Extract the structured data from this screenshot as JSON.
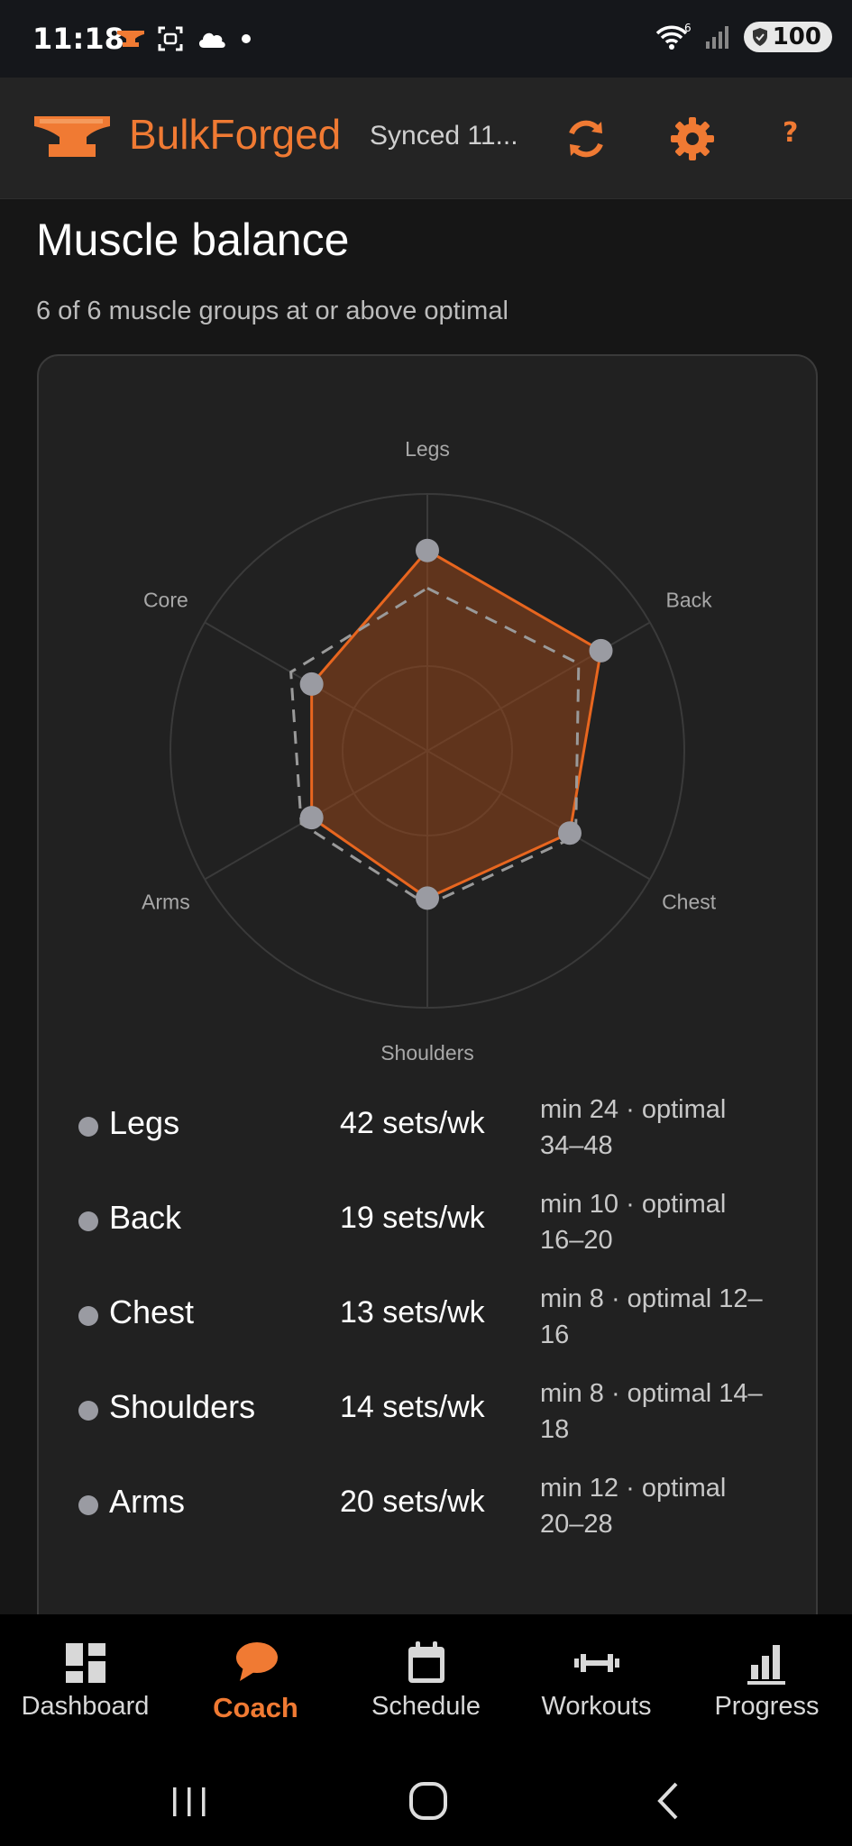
{
  "status_bar": {
    "time": "11:18",
    "signal_badge": "6",
    "battery": "100"
  },
  "app_bar": {
    "brand": "BulkForged",
    "sync_status": "Synced 11...",
    "help_label": "?",
    "accent_color": "#f07a33"
  },
  "page": {
    "title": "Muscle balance",
    "subtitle": "6 of 6 muscle groups at or above optimal"
  },
  "chart_data": {
    "type": "radar",
    "axes": [
      "Legs",
      "Back",
      "Chest",
      "Shoulders",
      "Arms",
      "Core"
    ],
    "series": [
      {
        "values": [
          1.17,
          1.17,
          0.96,
          0.86,
          0.78,
          0.78
        ],
        "color": "#e8661f"
      },
      {
        "values": [
          0.95,
          1.02,
          1.0,
          0.9,
          0.85,
          0.92
        ],
        "style": "dashed",
        "color": "#9a9a9a"
      }
    ],
    "range": [
      0,
      1.5
    ],
    "grid": "circular"
  },
  "legend": [
    {
      "name": "Legs",
      "sets": "42 sets/wk",
      "range": "min 24 · optimal 34–48"
    },
    {
      "name": "Back",
      "sets": "19 sets/wk",
      "range": "min 10 · optimal 16–20"
    },
    {
      "name": "Chest",
      "sets": "13 sets/wk",
      "range": "min 8 · optimal 12–16"
    },
    {
      "name": "Shoulders",
      "sets": "14 sets/wk",
      "range": "min 8 · optimal 14–18"
    },
    {
      "name": "Arms",
      "sets": "20 sets/wk",
      "range": "min 12 · optimal 20–28"
    }
  ],
  "nav": [
    {
      "label": "Dashboard",
      "icon": "dashboard-icon",
      "active": false
    },
    {
      "label": "Coach",
      "icon": "chat-bubble-icon",
      "active": true
    },
    {
      "label": "Schedule",
      "icon": "calendar-icon",
      "active": false
    },
    {
      "label": "Workouts",
      "icon": "dumbbell-icon",
      "active": false
    },
    {
      "label": "Progress",
      "icon": "bar-chart-icon",
      "active": false
    }
  ]
}
